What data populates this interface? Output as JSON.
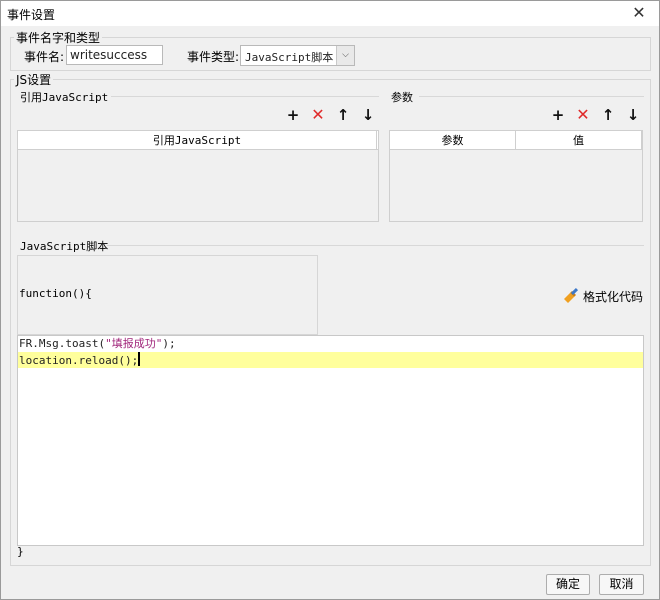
{
  "window": {
    "title": "事件设置",
    "close_glyph": "✕"
  },
  "event_group": {
    "legend": "事件名字和类型",
    "name_label": "事件名:",
    "name_value": "writesuccess",
    "type_label": "事件类型:",
    "type_value": "JavaScript脚本"
  },
  "js_group": {
    "legend": "JS设置",
    "ref_js": {
      "title": "引用JavaScript",
      "columns": [
        "引用JavaScript"
      ]
    },
    "params": {
      "title": "参数",
      "columns": [
        "参数",
        "值"
      ]
    },
    "toolbar_icons": [
      "add-icon",
      "delete-icon",
      "arrow-up-icon",
      "arrow-down-icon"
    ],
    "script": {
      "title": "JavaScript脚本",
      "prefix": "function(){",
      "format_label": "格式化代码",
      "lines": [
        {
          "before": "FR.Msg.toast(",
          "string": "\"填报成功\"",
          "after": ");"
        },
        {
          "before": "location.reload();",
          "string": "",
          "after": ""
        }
      ],
      "suffix": "}"
    }
  },
  "footer": {
    "ok_label": "确定",
    "cancel_label": "取消"
  },
  "colors": {
    "delete": "#e02a2a",
    "string_literal": "#a0257a",
    "current_line": "#ffff9c"
  }
}
